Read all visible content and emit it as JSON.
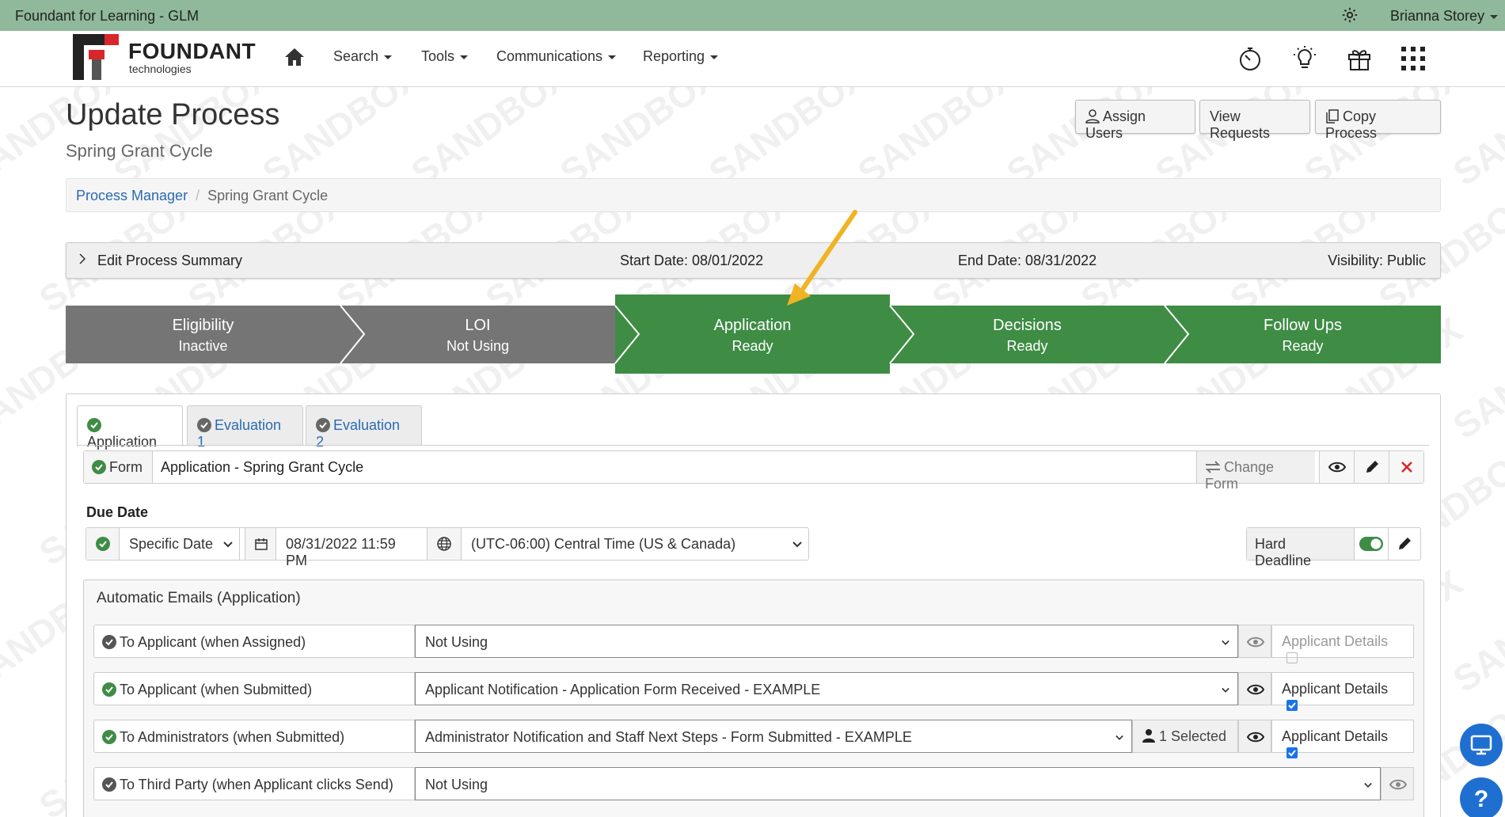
{
  "topbar": {
    "app_title": "Foundant for Learning - GLM",
    "user": "Brianna Storey"
  },
  "nav": {
    "brand": "FOUNDANT",
    "brand_sub": "technologies",
    "menus": [
      "Search",
      "Tools",
      "Communications",
      "Reporting"
    ]
  },
  "watermark": "SANDBOX",
  "page": {
    "title": "Update Process",
    "subtitle": "Spring Grant Cycle",
    "buttons": {
      "assign": "Assign Users",
      "view": "View Requests",
      "copy": "Copy Process"
    }
  },
  "breadcrumb": {
    "parent": "Process Manager",
    "sep": "/",
    "current": "Spring Grant Cycle"
  },
  "summary": {
    "label": "Edit Process Summary",
    "start": "Start Date: 08/01/2022",
    "end": "End Date: 08/31/2022",
    "visibility": "Visibility: Public"
  },
  "steps": [
    {
      "name": "Eligibility",
      "status": "Inactive",
      "color": "#757575"
    },
    {
      "name": "LOI",
      "status": "Not Using",
      "color": "#757575"
    },
    {
      "name": "Application",
      "status": "Ready",
      "color": "#3f8c45"
    },
    {
      "name": "Decisions",
      "status": "Ready",
      "color": "#3f8c45"
    },
    {
      "name": "Follow Ups",
      "status": "Ready",
      "color": "#3f8c45"
    }
  ],
  "tabs": [
    "Application",
    "Evaluation 1",
    "Evaluation 2"
  ],
  "form": {
    "label": "Form",
    "value": "Application - Spring Grant Cycle",
    "change": "Change Form"
  },
  "due": {
    "label": "Due Date",
    "type": "Specific Date",
    "date": "08/31/2022 11:59 PM",
    "timezone": "(UTC-06:00) Central Time (US & Canada)",
    "hard_deadline": "Hard Deadline"
  },
  "emails": {
    "title": "Automatic Emails (Application)",
    "rows": [
      {
        "name": "To Applicant (when Assigned)",
        "template": "Not Using",
        "details": "Applicant Details",
        "checked": false
      },
      {
        "name": "To Applicant (when Submitted)",
        "template": "Applicant Notification - Application Form Received - EXAMPLE",
        "details": "Applicant Details",
        "checked": true
      },
      {
        "name": "To Administrators (when Submitted)",
        "template": "Administrator Notification and Staff Next Steps - Form Submitted - EXAMPLE",
        "selected": "1 Selected",
        "details": "Applicant Details",
        "checked": true
      },
      {
        "name": "To Third Party (when Applicant clicks Send)",
        "template": "Not Using"
      }
    ]
  },
  "colors": {
    "topbar": "#8fb99a",
    "green": "#3f8c45",
    "gray": "#757575",
    "link": "#2a6ab1",
    "accent": "#f0b323"
  }
}
